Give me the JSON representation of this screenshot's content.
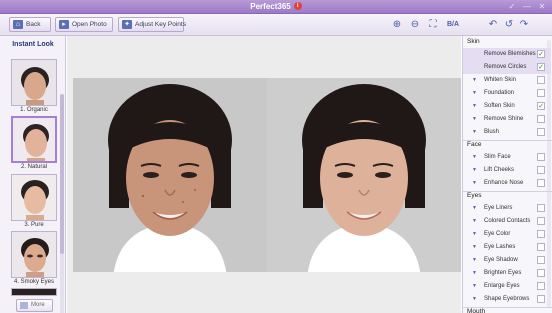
{
  "window": {
    "title": "Perfect365",
    "info_glyph": "i",
    "controls": [
      "✓",
      "—",
      "✕"
    ]
  },
  "toolbar": {
    "back_label": "Back",
    "open_photo_label": "Open Photo",
    "adjust_key_points_label": "Adjust Key Points",
    "zoom_in_icon": "zoom-in-icon",
    "zoom_out_icon": "zoom-out-icon",
    "fit_icon": "fit-icon",
    "compare_label": "B/A",
    "undo_icon": "undo-icon",
    "redo_icon": "redo-icon"
  },
  "instant_look": {
    "heading": "Instant Look",
    "items": [
      {
        "label": "1. Organic"
      },
      {
        "label": "2. Natural"
      },
      {
        "label": "3. Pure"
      },
      {
        "label": "4. Smoky Eyes"
      }
    ],
    "selected_index": 1,
    "more_label": "More"
  },
  "panel": {
    "sections": [
      {
        "title": "Skin",
        "items": [
          {
            "label": "Remove Blemishes",
            "checked": true,
            "expandable": false
          },
          {
            "label": "Remove Circles",
            "checked": true,
            "expandable": false
          },
          {
            "label": "Whiten Skin",
            "checked": false,
            "expandable": true
          },
          {
            "label": "Foundation",
            "checked": false,
            "expandable": true
          },
          {
            "label": "Soften Skin",
            "checked": true,
            "expandable": true
          },
          {
            "label": "Remove Shine",
            "checked": false,
            "expandable": true
          },
          {
            "label": "Blush",
            "checked": false,
            "expandable": true
          }
        ]
      },
      {
        "title": "Face",
        "items": [
          {
            "label": "Slim Face",
            "checked": false,
            "expandable": true
          },
          {
            "label": "Lift Cheeks",
            "checked": false,
            "expandable": true
          },
          {
            "label": "Enhance Nose",
            "checked": false,
            "expandable": true
          }
        ]
      },
      {
        "title": "Eyes",
        "items": [
          {
            "label": "Eye Liners",
            "checked": false,
            "expandable": true
          },
          {
            "label": "Colored Contacts",
            "checked": false,
            "expandable": true
          },
          {
            "label": "Eye Color",
            "checked": false,
            "expandable": true
          },
          {
            "label": "Eye Lashes",
            "checked": false,
            "expandable": true
          },
          {
            "label": "Eye Shadow",
            "checked": false,
            "expandable": true
          },
          {
            "label": "Brighten Eyes",
            "checked": false,
            "expandable": true
          },
          {
            "label": "Enlarge Eyes",
            "checked": false,
            "expandable": true
          },
          {
            "label": "Shape Eyebrows",
            "checked": false,
            "expandable": true
          }
        ]
      },
      {
        "title": "Mouth",
        "items": []
      }
    ]
  },
  "colors": {
    "title_bar": "#a889cf",
    "accent": "#4b5ba8",
    "check": "#2b8a2b"
  }
}
